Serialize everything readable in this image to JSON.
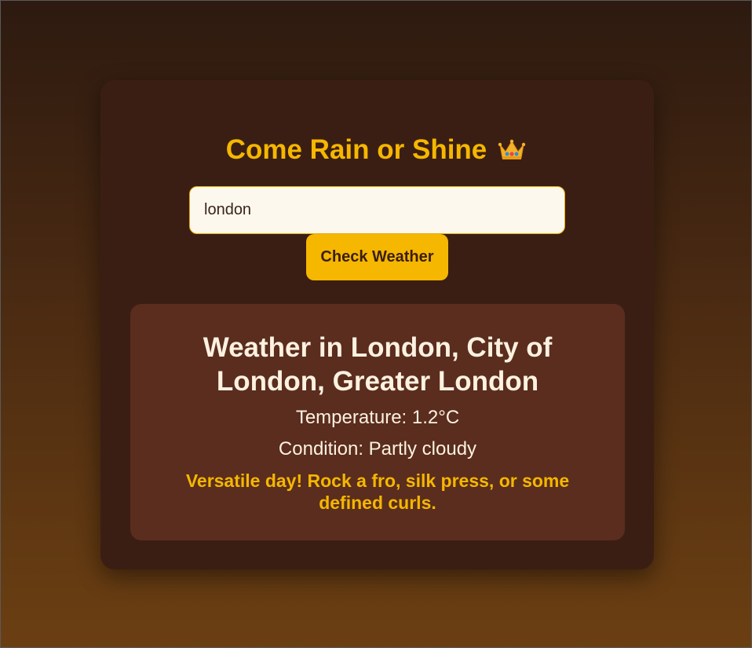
{
  "app": {
    "title": "Come Rain or Shine",
    "title_icon": "crown-icon"
  },
  "search": {
    "value": "london",
    "button_label": "Check Weather"
  },
  "result": {
    "heading": "Weather in London, City of London, Greater London",
    "temperature": "Temperature: 1.2°C",
    "condition": "Condition: Partly cloudy",
    "tip": "Versatile day! Rock a fro, silk press, or some defined curls."
  },
  "colors": {
    "accent": "#f5b700",
    "card_bg": "#3b1e13",
    "result_bg": "#5a2d1e",
    "text_light": "#fdf1e0"
  }
}
